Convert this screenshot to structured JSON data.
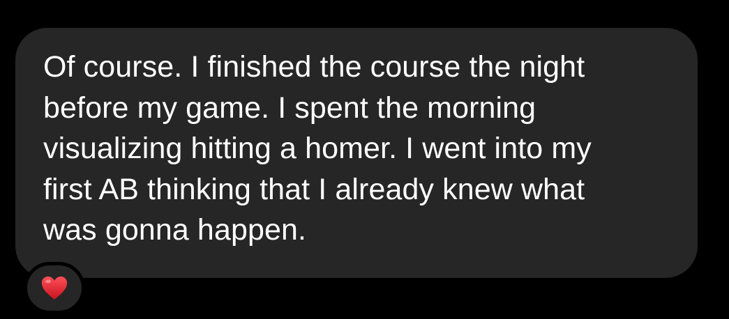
{
  "message": {
    "lines": [
      "Of course. I finished the course the night",
      "before my game. I spent the morning",
      "visualizing hitting a homer. I went into my",
      "first AB thinking that I already knew what",
      "was gonna happen."
    ]
  },
  "reaction": {
    "icon": "red-heart-icon",
    "color": "#e0242c"
  },
  "colors": {
    "background": "#000000",
    "bubble": "#262626",
    "text": "#ffffff"
  }
}
